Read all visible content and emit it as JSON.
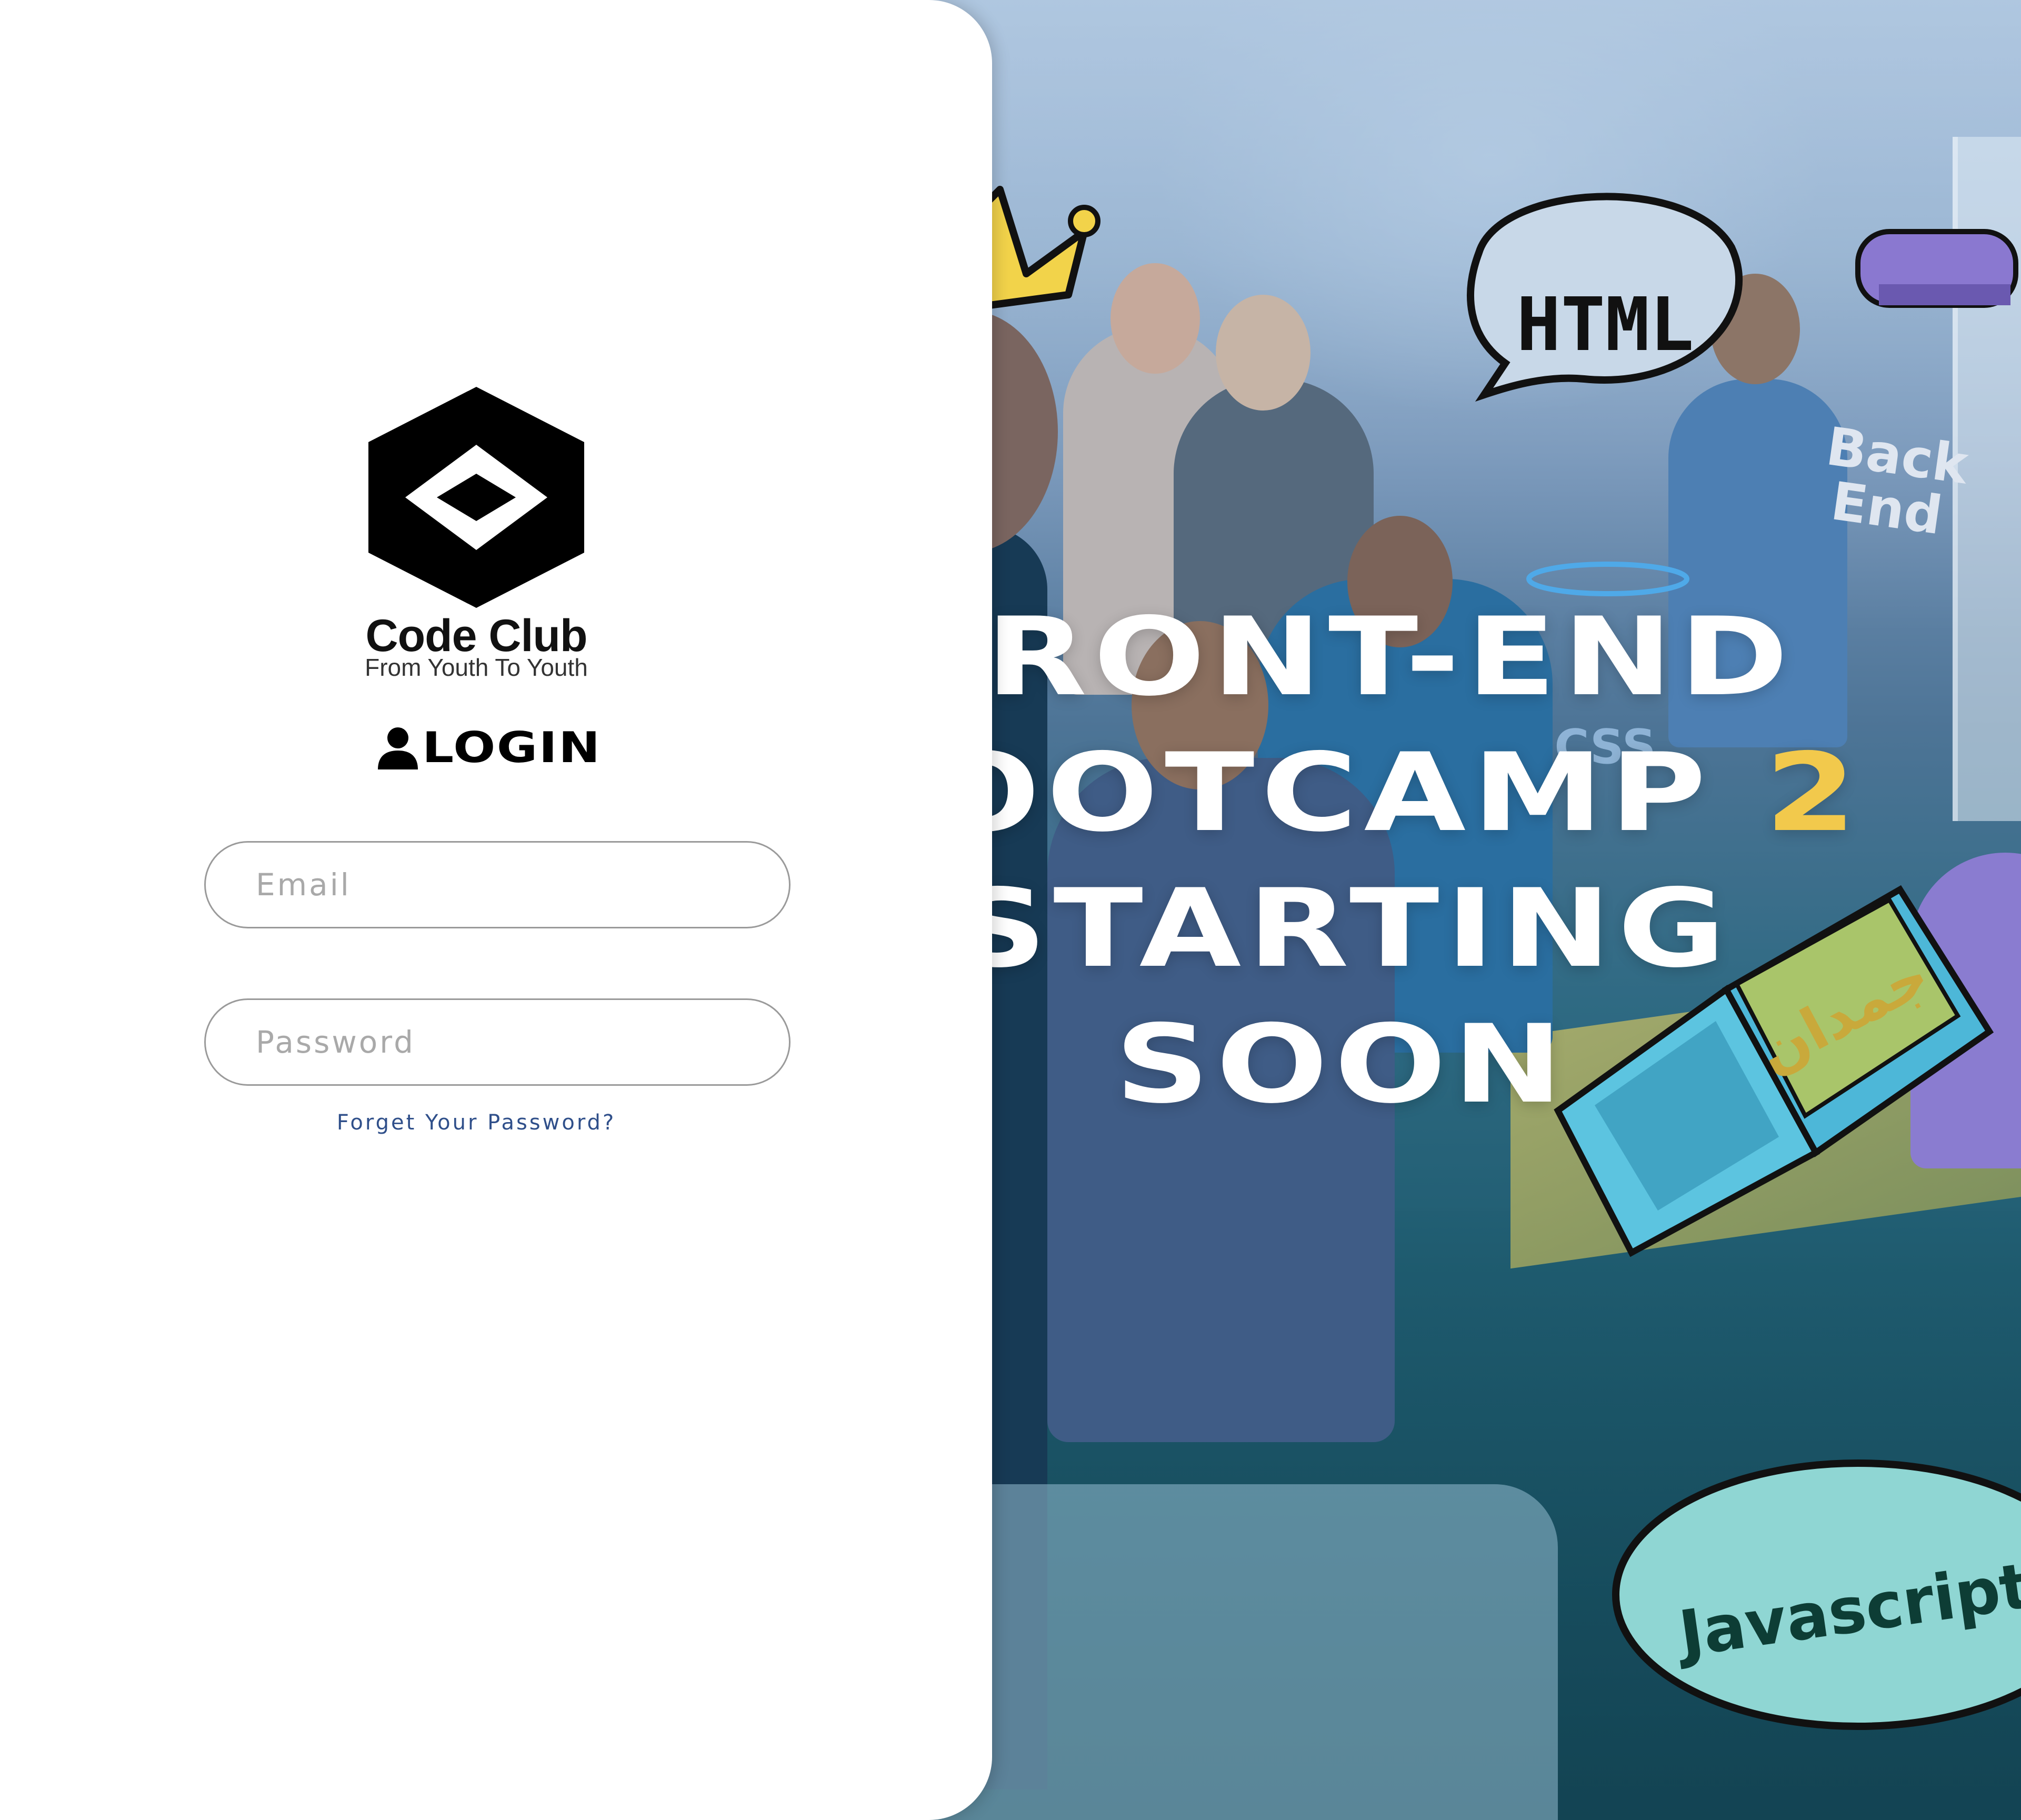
{
  "brand": {
    "name": "Code Club",
    "tagline": "From Youth To Youth"
  },
  "login": {
    "title": "LOGIN",
    "email_placeholder": "Email",
    "password_placeholder": "Password",
    "forgot_link": "Forget Your Password?"
  },
  "hero": {
    "line1": "FRONT-END",
    "line2_main": "BOOTCAMP ",
    "line2_accent": "2",
    "line3": "STARTING",
    "line4": "SOON",
    "accent_color": "#f2c94c",
    "doodles": {
      "bubble_html": "HTML",
      "shirt_text_1": "Back",
      "shirt_text_2": "End",
      "bubble_js": "Javascript",
      "shirt_css": "CSS",
      "laptop_text": "جمدان"
    }
  }
}
